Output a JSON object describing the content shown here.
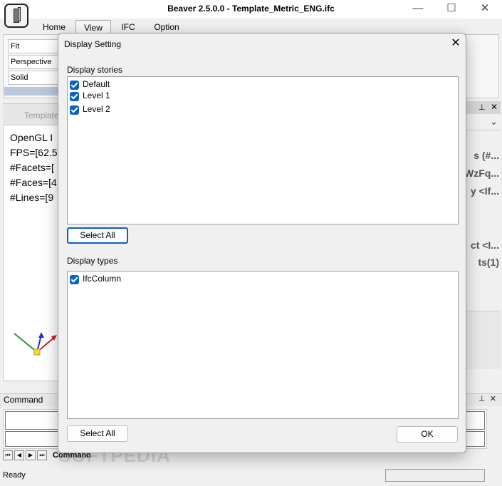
{
  "app": {
    "title": "Beaver 2.5.0.0  - Template_Metric_ENG.ifc",
    "window_controls": [
      "—",
      "☐",
      "✕"
    ]
  },
  "ribbon": {
    "tabs": [
      {
        "label": "Home"
      },
      {
        "label": "View"
      },
      {
        "label": "IFC"
      },
      {
        "label": "Option"
      }
    ],
    "items": [
      "Fit",
      "Perspective",
      "Solid"
    ]
  },
  "document": {
    "tab_label": "Template",
    "gl_info": [
      "OpenGL I",
      "FPS=[62.5",
      "#Facets=[",
      "#Faces=[4",
      "#Lines=[9"
    ]
  },
  "right_panel": {
    "header_icons": [
      "pin-icon",
      "close-icon"
    ],
    "dropdown": "⌄",
    "texts": [
      "s (#...",
      "WzFq...",
      "y <If...",
      "ct <I...",
      "ts(1)"
    ]
  },
  "command": {
    "label": "Command",
    "tab_label": "Command",
    "nav": [
      "⏮",
      "◀",
      "▶",
      "⏭"
    ]
  },
  "status": {
    "text": "Ready"
  },
  "watermark": "SOFTPEDIA",
  "dialog": {
    "title": "Display Setting",
    "stories": {
      "label": "Display stories",
      "items": [
        {
          "label": "Default",
          "checked": true
        },
        {
          "label": "Level 1",
          "checked": true
        },
        {
          "label": "Level 2",
          "checked": true
        }
      ],
      "select_all": "Select All"
    },
    "types": {
      "label": "Display types",
      "items": [
        {
          "label": "IfcColumn",
          "checked": true
        }
      ],
      "select_all": "Select All"
    },
    "ok": "OK"
  },
  "colors": {
    "accent": "#0a62c2",
    "axis_x": "#d22020",
    "axis_y": "#20a020",
    "axis_z": "#2030d0"
  }
}
